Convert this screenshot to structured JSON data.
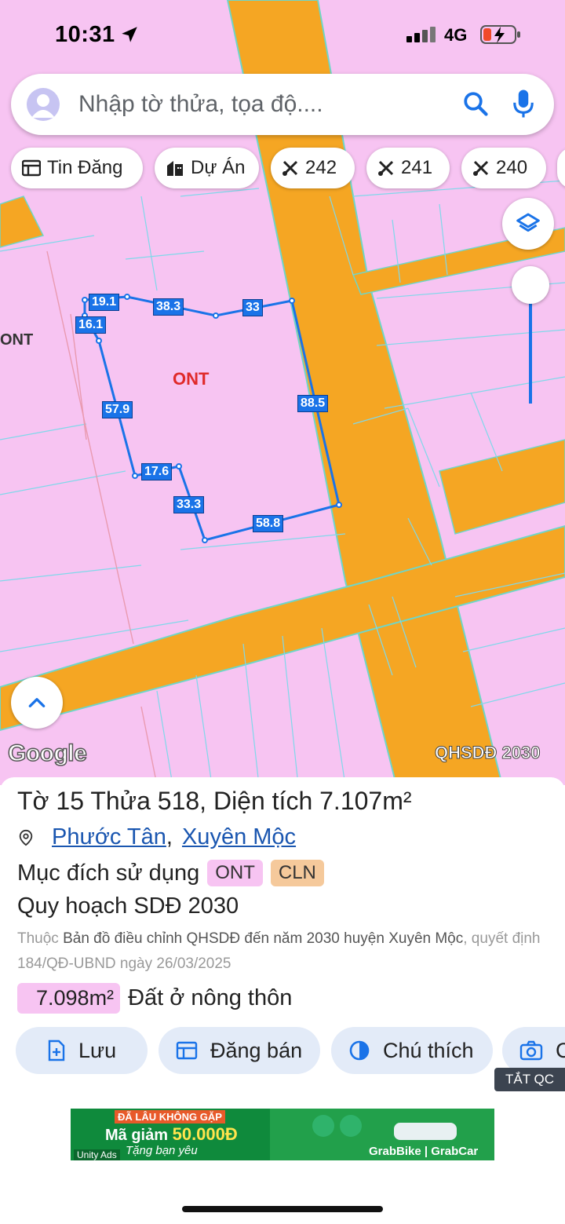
{
  "status_bar": {
    "time": "10:31",
    "network": "4G"
  },
  "search": {
    "placeholder": "Nhập tờ thửa, tọa độ...."
  },
  "chips": [
    {
      "label": "Tin Đăng",
      "icon": "newspaper-icon"
    },
    {
      "label": "Dự Án",
      "icon": "building-icon"
    },
    {
      "label": "242",
      "icon": "tools-icon"
    },
    {
      "label": "241",
      "icon": "tools-icon"
    },
    {
      "label": "240",
      "icon": "tools-icon"
    }
  ],
  "map": {
    "zone_label": "ONT",
    "zone_label_left": "ONT",
    "edge_lengths": [
      "19.1",
      "38.3",
      "33",
      "16.1",
      "57.9",
      "88.5",
      "17.6",
      "33.3",
      "58.8"
    ],
    "google_logo": "Google",
    "layer_name": "QHSDĐ 2030",
    "colors": {
      "residential": "#f7c4f2",
      "road": "#f5a623",
      "parcel_outline": "#1a73e8"
    }
  },
  "info": {
    "title_prefix": "Tờ",
    "sheet_no": "15",
    "parcel_word": "Thửa",
    "parcel_no": "518",
    "area_label": ", Diện tích",
    "area_value": "7.107m²",
    "commune": "Phước Tân",
    "district": "Xuyên Mộc",
    "purpose_label": "Mục đích sử dụng",
    "purpose_tags": [
      "ONT",
      "CLN"
    ],
    "plan_label": "Quy hoạch SDĐ 2030",
    "desc_prefix": "Thuộc",
    "desc_map": "Bản đồ điều chỉnh QHSDĐ đến năm 2030 huyện Xuyên Mộc",
    "desc_decision": ", quyết định 184/QĐ-UBND ngày 26/03/2025",
    "sub_area": "7.098m²",
    "sub_area_type": "Đất ở nông thôn"
  },
  "actions": [
    {
      "label": "Lưu",
      "icon": "add-file-icon"
    },
    {
      "label": "Đăng bán",
      "icon": "listing-icon"
    },
    {
      "label": "Chú thích",
      "icon": "contrast-icon"
    },
    {
      "label": "C",
      "icon": "camera-icon"
    }
  ],
  "ad": {
    "close_label": "TẮT QC",
    "line1": "ĐÃ LÂU KHÔNG GẶP",
    "line2_prefix": "Mã giảm",
    "line2_amount": "50.000Đ",
    "line3": "Tặng bạn yêu",
    "brand": "GrabBike | GrabCar",
    "network": "Unity Ads"
  }
}
